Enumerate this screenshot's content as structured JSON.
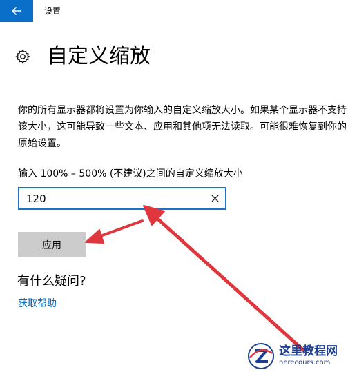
{
  "window": {
    "title": "设置",
    "back_icon": "back-arrow-icon",
    "back_color": "#0a6fc9"
  },
  "header": {
    "icon": "gear-icon",
    "title": "自定义缩放"
  },
  "main": {
    "description": "你的所有显示器都将设置为你输入的自定义缩放大小。如果某个显示器不支持该大小，这可能导致一些文本、应用和其他项无法读取。可能很难恢复到你的原始设置。",
    "input_label": "输入 100% – 500% (不建议)之间的自定义缩放大小",
    "scale_value": "120",
    "clear_icon": "close-icon",
    "apply_label": "应用",
    "field_border_color": "#1a72c3",
    "apply_bg_color": "#cccccc"
  },
  "faq": {
    "heading": "有什么疑问?",
    "link_label": "获取帮助",
    "link_color": "#0a6cbf"
  },
  "annotation": {
    "arrow_color": "#e0373f"
  },
  "watermark": {
    "title": "这里教程网",
    "url": "herecours.com"
  }
}
